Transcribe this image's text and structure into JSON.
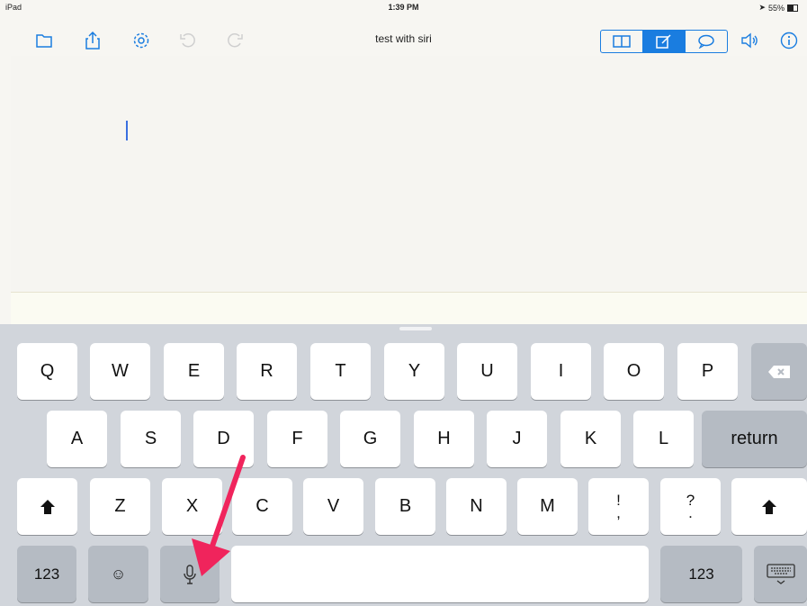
{
  "status_bar": {
    "device": "iPad",
    "time": "1:39 PM",
    "battery": "55%",
    "battery_level": 0.55
  },
  "toolbar": {
    "title": "test with siri",
    "left_icons": [
      "folder-icon",
      "share-icon",
      "gear-icon",
      "undo-icon",
      "redo-icon"
    ],
    "view_modes": [
      {
        "name": "split-view-icon",
        "active": false
      },
      {
        "name": "edit-icon",
        "active": true
      },
      {
        "name": "speech-bubble-icon",
        "active": false
      }
    ],
    "right_icons": [
      "speaker-icon",
      "info-icon"
    ]
  },
  "colors": {
    "accent": "#1a7de0",
    "arrow": "#f0245c",
    "keyboard_bg": "#d1d5db"
  },
  "keyboard": {
    "row1": [
      "Q",
      "W",
      "E",
      "R",
      "T",
      "Y",
      "U",
      "I",
      "O",
      "P"
    ],
    "row2": [
      "A",
      "S",
      "D",
      "F",
      "G",
      "H",
      "J",
      "K",
      "L"
    ],
    "row3": [
      "Z",
      "X",
      "C",
      "V",
      "B",
      "N",
      "M"
    ],
    "punct1": {
      "top": "!",
      "bottom": ","
    },
    "punct2": {
      "top": "?",
      "bottom": "."
    },
    "return_label": "return",
    "numbers_left": "123",
    "numbers_right": "123",
    "emoji_label": "☺"
  }
}
